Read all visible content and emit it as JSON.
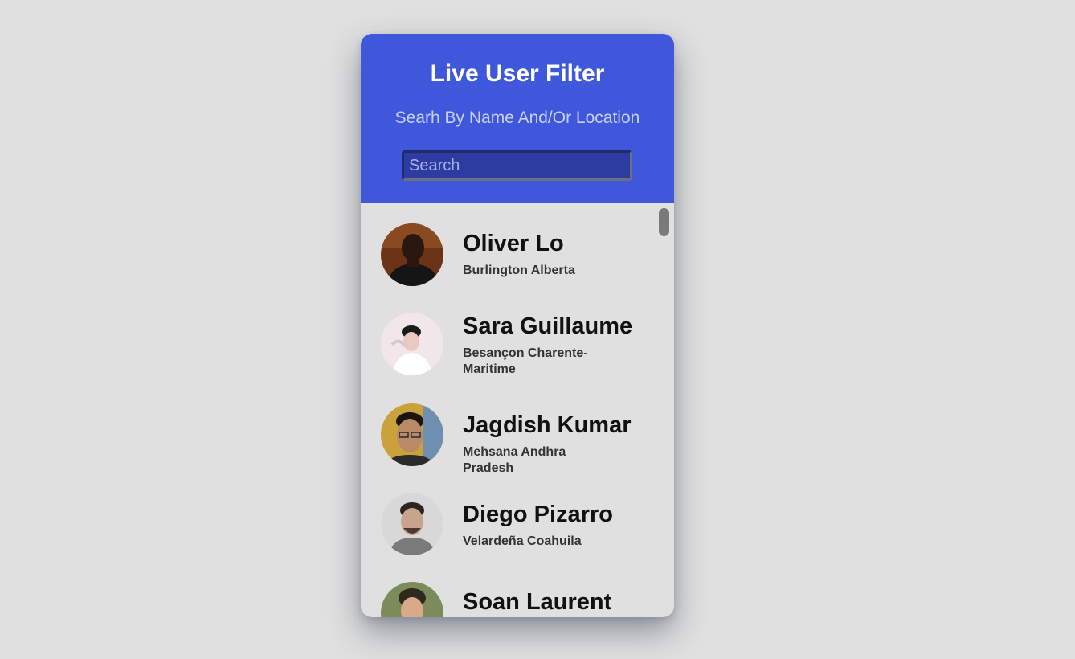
{
  "header": {
    "title": "Live User Filter",
    "subtitle": "Searh By Name And/Or Location",
    "search_placeholder": "Search",
    "search_value": ""
  },
  "colors": {
    "header_bg": "#3f57db",
    "page_bg": "#e0e0e0",
    "search_bg": "#2c3ca0"
  },
  "users": [
    {
      "name": "Oliver Lo",
      "location": "Burlington Alberta",
      "avatar": "user-photo"
    },
    {
      "name": "Sara Guillaume",
      "location": "Besançon Charente-Maritime",
      "avatar": "user-photo"
    },
    {
      "name": "Jagdish Kumar",
      "location": "Mehsana Andhra Pradesh",
      "avatar": "user-photo"
    },
    {
      "name": "Diego Pizarro",
      "location": "Velardeña Coahuila",
      "avatar": "user-photo"
    },
    {
      "name": "Soan Laurent",
      "location": "",
      "avatar": "user-photo"
    }
  ]
}
